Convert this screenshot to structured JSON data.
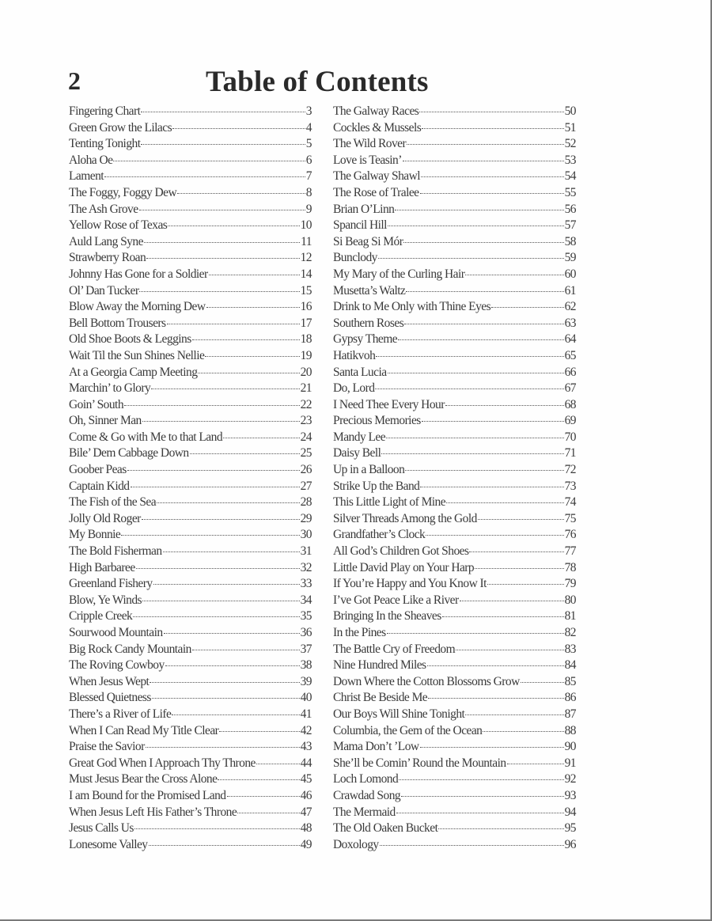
{
  "page": {
    "number": "2",
    "title": "Table of Contents"
  },
  "toc": {
    "left": [
      {
        "title": "Fingering Chart",
        "page": "3"
      },
      {
        "title": "Green Grow the Lilacs",
        "page": "4"
      },
      {
        "title": "Tenting  Tonight",
        "page": "5"
      },
      {
        "title": "Aloha Oe",
        "page": "6"
      },
      {
        "title": "Lament",
        "page": "7"
      },
      {
        "title": "The Foggy, Foggy Dew",
        "page": "8"
      },
      {
        "title": "The Ash Grove",
        "page": "9"
      },
      {
        "title": "Yellow Rose of Texas",
        "page": "10"
      },
      {
        "title": "Auld Lang Syne",
        "page": "11"
      },
      {
        "title": "Strawberry Roan",
        "page": "12"
      },
      {
        "title": "Johnny Has Gone for a Soldier",
        "page": "14"
      },
      {
        "title": "Ol’ Dan Tucker",
        "page": "15"
      },
      {
        "title": "Blow Away the Morning Dew",
        "page": "16"
      },
      {
        "title": "Bell Bottom Trousers",
        "page": "17"
      },
      {
        "title": "Old Shoe Boots & Leggins",
        "page": "18"
      },
      {
        "title": "Wait Til the Sun Shines Nellie",
        "page": "19"
      },
      {
        "title": "At a Georgia Camp Meeting",
        "page": "20"
      },
      {
        "title": "Marchin’ to Glory",
        "page": "21"
      },
      {
        "title": "Goin’ South",
        "page": "22"
      },
      {
        "title": "Oh, Sinner Man",
        "page": "23"
      },
      {
        "title": "Come & Go with Me to that Land",
        "page": "24"
      },
      {
        "title": "Bile’ Dem Cabbage Down",
        "page": "25"
      },
      {
        "title": "Goober Peas",
        "page": "26"
      },
      {
        "title": "Captain Kidd",
        "page": "27"
      },
      {
        "title": "The Fish of the Sea",
        "page": "28"
      },
      {
        "title": "Jolly Old Roger",
        "page": "29"
      },
      {
        "title": "My Bonnie",
        "page": "30"
      },
      {
        "title": "The Bold Fisherman",
        "page": "31"
      },
      {
        "title": "High Barbaree",
        "page": "32"
      },
      {
        "title": "Greenland Fishery",
        "page": "33"
      },
      {
        "title": "Blow, Ye Winds",
        "page": "34"
      },
      {
        "title": "Cripple Creek",
        "page": "35"
      },
      {
        "title": "Sourwood Mountain",
        "page": "36"
      },
      {
        "title": "Big Rock Candy Mountain",
        "page": "37"
      },
      {
        "title": "The Roving Cowboy",
        "page": "38"
      },
      {
        "title": "When Jesus Wept",
        "page": "39"
      },
      {
        "title": "Blessed Quietness",
        "page": "40"
      },
      {
        "title": "There’s a River of Life",
        "page": "41"
      },
      {
        "title": "When I Can Read My Title Clear",
        "page": "42"
      },
      {
        "title": "Praise the Savior",
        "page": "43"
      },
      {
        "title": "Great God When I Approach Thy Throne",
        "page": "44"
      },
      {
        "title": "Must Jesus Bear the Cross Alone",
        "page": "45"
      },
      {
        "title": "I am Bound for the Promised Land",
        "page": "46"
      },
      {
        "title": "When Jesus Left His Father’s Throne",
        "page": "47"
      },
      {
        "title": "Jesus Calls Us",
        "page": "48"
      },
      {
        "title": "Lonesome Valley",
        "page": "49"
      }
    ],
    "right": [
      {
        "title": "The Galway Races",
        "page": "50"
      },
      {
        "title": "Cockles & Mussels",
        "page": "51"
      },
      {
        "title": "The Wild Rover",
        "page": "52"
      },
      {
        "title": "Love is Teasin’",
        "page": "53"
      },
      {
        "title": "The Galway Shawl",
        "page": "54"
      },
      {
        "title": "The Rose of Tralee",
        "page": "55"
      },
      {
        "title": "Brian O’Linn",
        "page": "56"
      },
      {
        "title": "Spancil Hill",
        "page": "57"
      },
      {
        "title": "Si Beag Si Mór",
        "page": "58"
      },
      {
        "title": "Bunclody",
        "page": "59"
      },
      {
        "title": "My Mary of the Curling Hair",
        "page": "60"
      },
      {
        "title": "Musetta’s Waltz",
        "page": "61"
      },
      {
        "title": "Drink to Me Only with Thine Eyes",
        "page": "62"
      },
      {
        "title": "Southern Roses",
        "page": "63"
      },
      {
        "title": "Gypsy Theme",
        "page": "64"
      },
      {
        "title": "Hatikvoh",
        "page": "65"
      },
      {
        "title": "Santa Lucia",
        "page": "66"
      },
      {
        "title": "Do, Lord",
        "page": "67"
      },
      {
        "title": "I Need Thee Every Hour",
        "page": "68"
      },
      {
        "title": "Precious Memories",
        "page": "69"
      },
      {
        "title": "Mandy Lee",
        "page": "70"
      },
      {
        "title": "Daisy Bell",
        "page": "71"
      },
      {
        "title": "Up in a Balloon",
        "page": "72"
      },
      {
        "title": "Strike Up the Band",
        "page": "73"
      },
      {
        "title": "This Little Light of Mine",
        "page": "74"
      },
      {
        "title": "Silver Threads Among the Gold",
        "page": "75"
      },
      {
        "title": "Grandfather’s Clock",
        "page": "76"
      },
      {
        "title": "All God’s Children Got Shoes",
        "page": "77"
      },
      {
        "title": "Little David Play on Your Harp",
        "page": "78"
      },
      {
        "title": "If You’re Happy and You Know It",
        "page": "79"
      },
      {
        "title": "I’ve Got Peace Like a River",
        "page": "80"
      },
      {
        "title": "Bringing In the Sheaves",
        "page": "81"
      },
      {
        "title": "In the Pines",
        "page": "82"
      },
      {
        "title": "The Battle Cry of Freedom",
        "page": "83"
      },
      {
        "title": "Nine Hundred Miles",
        "page": "84"
      },
      {
        "title": "Down Where the Cotton Blossoms Grow",
        "page": "85"
      },
      {
        "title": "Christ Be Beside Me",
        "page": "86"
      },
      {
        "title": "Our Boys Will Shine Tonight",
        "page": "87"
      },
      {
        "title": "Columbia, the Gem of the Ocean",
        "page": "88"
      },
      {
        "title": "Mama Don’t ’Low",
        "page": "90"
      },
      {
        "title": "She’ll be Comin’ Round the Mountain",
        "page": "91"
      },
      {
        "title": "Loch Lomond",
        "page": "92"
      },
      {
        "title": "Crawdad Song",
        "page": "93"
      },
      {
        "title": "The Mermaid",
        "page": "94"
      },
      {
        "title": "The Old Oaken Bucket",
        "page": "95"
      },
      {
        "title": "Doxology",
        "page": "96"
      }
    ]
  }
}
